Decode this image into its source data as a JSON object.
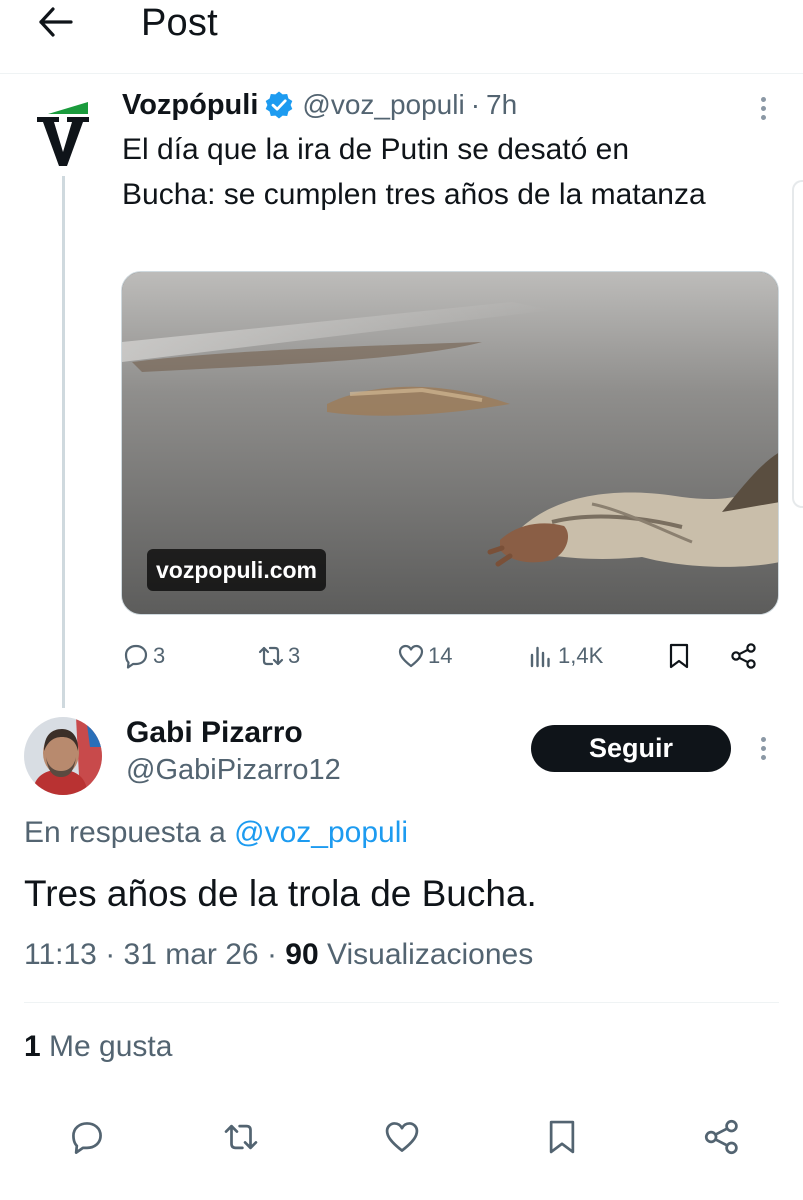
{
  "header": {
    "title": "Post",
    "back_icon": "arrow-left-icon"
  },
  "quoted_post": {
    "author_name": "Vozpópuli",
    "handle": "@voz_populi",
    "separator": "·",
    "time": "7h",
    "verified": true,
    "avatar_letter": "V",
    "text": "El día que la ira de Putin se desató en Bucha: se cumplen tres años de la matanza",
    "media_badge": "vozpopuli.com",
    "stats": {
      "replies": "3",
      "reposts": "3",
      "likes": "14",
      "views": "1,4K"
    },
    "colors": {
      "verified": "#1d9bf0",
      "brand_green": "#1a9b3c"
    }
  },
  "reply_post": {
    "author_name": "Gabi Pizarro",
    "handle": "@GabiPizarro12",
    "follow_label": "Seguir",
    "reply_prefix": "En respuesta a",
    "reply_mention": "@voz_populi",
    "text": "Tres años de la trola de Bucha.",
    "time": "11:13",
    "date": "31 mar 26",
    "views_count": "90",
    "views_label": "Visualizaciones",
    "likes_count": "1",
    "likes_label": "Me gusta"
  },
  "colors": {
    "text_primary": "#0f1419",
    "text_secondary": "#536471",
    "link": "#1d9bf0",
    "border": "#eff3f4"
  }
}
